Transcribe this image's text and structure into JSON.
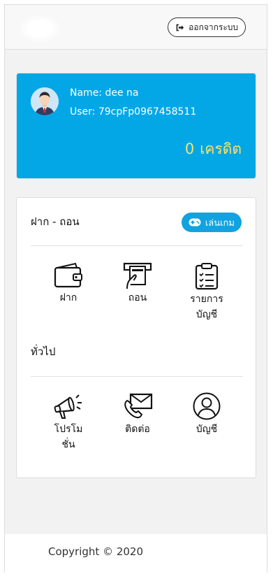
{
  "header": {
    "logout_label": "ออกจากระบบ",
    "logout_icon": "sign-out-icon"
  },
  "profile": {
    "name_line": "Name: dee na",
    "user_line": "User: 79cpFp0967458511",
    "credit_value": "0",
    "credit_label": "เครดิต",
    "colors": {
      "card": "#04a7e6",
      "credit": "#f8e36a"
    }
  },
  "deposit_withdraw": {
    "title": "ฝาก - ถอน",
    "play_button": "เล่นเกม",
    "items": [
      {
        "label": "ฝาก",
        "icon": "wallet-icon"
      },
      {
        "label": "ถอน",
        "icon": "atm-withdraw-icon"
      },
      {
        "label_line1": "รายการ",
        "label_line2": "บัญชี",
        "icon": "clipboard-list-icon"
      }
    ]
  },
  "general": {
    "title": "ทั่วไป",
    "items": [
      {
        "label_line1": "โปรโม",
        "label_line2": "ชั่น",
        "icon": "megaphone-icon"
      },
      {
        "label": "ติดต่อ",
        "icon": "contact-phone-icon"
      },
      {
        "label": "บัญชี",
        "icon": "user-circle-icon"
      }
    ]
  },
  "footer": {
    "copyright": "Copyright © 2020"
  }
}
